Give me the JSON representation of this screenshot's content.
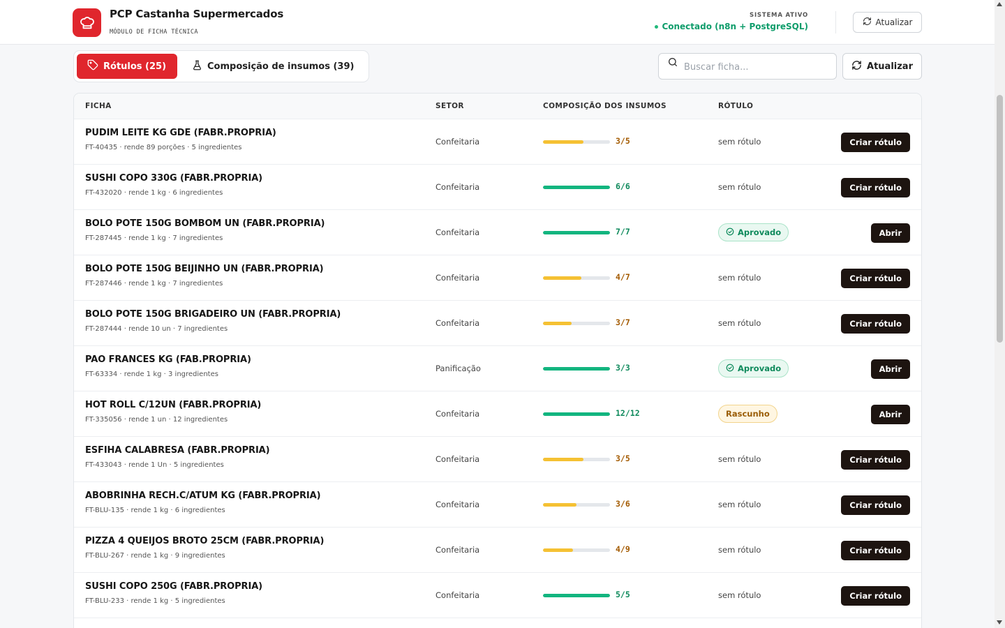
{
  "header": {
    "title": "PCP Castanha Supermercados",
    "subtitle": "MÓDULO DE FICHA TÉCNICA",
    "system_label": "SISTEMA ATIVO",
    "system_status": "Conectado (n8n + PostgreSQL)",
    "refresh_label": "Atualizar"
  },
  "toolbar": {
    "tab_rotulos": "Rótulos (25)",
    "tab_composicao": "Composição de insumos (39)",
    "search_placeholder": "Buscar ficha...",
    "refresh_label": "Atualizar"
  },
  "table": {
    "headers": {
      "ficha": "FICHA",
      "setor": "SETOR",
      "composicao": "COMPOSIÇÃO DOS INSUMOS",
      "rotulo": "RÓTULO"
    },
    "rows": [
      {
        "title": "PUDIM LEITE KG GDE (FABR.PROPRIA)",
        "meta": "FT-40435 · rende 89 porções · 5 ingredientes",
        "setor": "Confeitaria",
        "done": 3,
        "total": 5,
        "count": "3/5",
        "complete": false,
        "rotulo": "sem rótulo",
        "badge": "",
        "action": "Criar rótulo"
      },
      {
        "title": "SUSHI COPO 330G (FABR.PROPRIA)",
        "meta": "FT-432020 · rende 1 kg · 6 ingredientes",
        "setor": "Confeitaria",
        "done": 6,
        "total": 6,
        "count": "6/6",
        "complete": true,
        "rotulo": "sem rótulo",
        "badge": "",
        "action": "Criar rótulo"
      },
      {
        "title": "BOLO POTE 150G BOMBOM UN (FABR.PROPRIA)",
        "meta": "FT-287445 · rende 1 kg · 7 ingredientes",
        "setor": "Confeitaria",
        "done": 7,
        "total": 7,
        "count": "7/7",
        "complete": true,
        "rotulo": "Aprovado",
        "badge": "aprovado",
        "action": "Abrir"
      },
      {
        "title": "BOLO POTE 150G BEIJINHO UN (FABR.PROPRIA)",
        "meta": "FT-287446 · rende 1 kg · 7 ingredientes",
        "setor": "Confeitaria",
        "done": 4,
        "total": 7,
        "count": "4/7",
        "complete": false,
        "rotulo": "sem rótulo",
        "badge": "",
        "action": "Criar rótulo"
      },
      {
        "title": "BOLO POTE 150G BRIGADEIRO UN (FABR.PROPRIA)",
        "meta": "FT-287444 · rende 10 un · 7 ingredientes",
        "setor": "Confeitaria",
        "done": 3,
        "total": 7,
        "count": "3/7",
        "complete": false,
        "rotulo": "sem rótulo",
        "badge": "",
        "action": "Criar rótulo"
      },
      {
        "title": "PAO FRANCES KG (FAB.PROPRIA)",
        "meta": "FT-63334 · rende 1 kg · 3 ingredientes",
        "setor": "Panificação",
        "done": 3,
        "total": 3,
        "count": "3/3",
        "complete": true,
        "rotulo": "Aprovado",
        "badge": "aprovado",
        "action": "Abrir"
      },
      {
        "title": "HOT ROLL C/12UN (FABR.PROPRIA)",
        "meta": "FT-335056 · rende 1 un · 12 ingredientes",
        "setor": "Confeitaria",
        "done": 12,
        "total": 12,
        "count": "12/12",
        "complete": true,
        "rotulo": "Rascunho",
        "badge": "rascunho",
        "action": "Abrir"
      },
      {
        "title": "ESFIHA CALABRESA (FABR.PROPRIA)",
        "meta": "FT-433043 · rende 1 Un · 5 ingredientes",
        "setor": "Confeitaria",
        "done": 3,
        "total": 5,
        "count": "3/5",
        "complete": false,
        "rotulo": "sem rótulo",
        "badge": "",
        "action": "Criar rótulo"
      },
      {
        "title": "ABOBRINHA RECH.C/ATUM KG (FABR.PROPRIA)",
        "meta": "FT-BLU-135 · rende 1 kg · 6 ingredientes",
        "setor": "Confeitaria",
        "done": 3,
        "total": 6,
        "count": "3/6",
        "complete": false,
        "rotulo": "sem rótulo",
        "badge": "",
        "action": "Criar rótulo"
      },
      {
        "title": "PIZZA 4 QUEIJOS BROTO 25CM (FABR.PROPRIA)",
        "meta": "FT-BLU-267 · rende 1 kg · 9 ingredientes",
        "setor": "Confeitaria",
        "done": 4,
        "total": 9,
        "count": "4/9",
        "complete": false,
        "rotulo": "sem rótulo",
        "badge": "",
        "action": "Criar rótulo"
      },
      {
        "title": "SUSHI COPO 250G (FABR.PROPRIA)",
        "meta": "FT-BLU-233 · rende 1 kg · 5 ingredientes",
        "setor": "Confeitaria",
        "done": 5,
        "total": 5,
        "count": "5/5",
        "complete": true,
        "rotulo": "sem rótulo",
        "badge": "",
        "action": "Criar rótulo"
      }
    ]
  },
  "colors": {
    "accent": "#e0262d",
    "complete": "#12b57f",
    "incomplete": "#f5c133",
    "complete_text": "#0f8a5c",
    "incomplete_text": "#a35a00",
    "dark_button": "#1d1410"
  },
  "icons": {
    "logo": "chef-hat-icon",
    "refresh": "refresh-icon",
    "tag": "tag-icon",
    "flask": "flask-icon",
    "search": "search-icon",
    "check": "check-circle-icon"
  }
}
